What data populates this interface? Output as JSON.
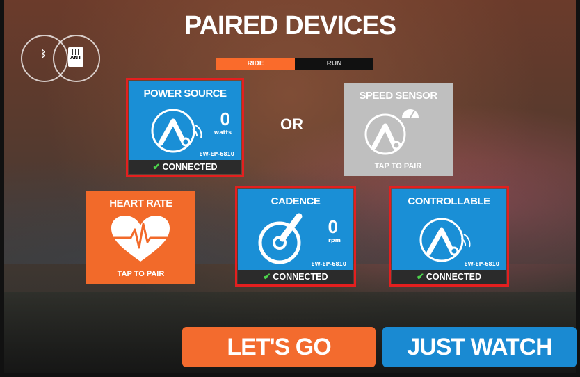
{
  "screen": {
    "title": "PAIRED DEVICES"
  },
  "sport_toggle": {
    "ride_label": "RIDE",
    "run_label": "RUN",
    "selected": "RIDE"
  },
  "connection_icons": {
    "bluetooth": "bluetooth-icon",
    "ant_label": "ANT"
  },
  "tiles": {
    "power_source": {
      "title": "POWER SOURCE",
      "value": "0",
      "unit": "watts",
      "device_id": "EW-EP-6810",
      "status": "CONNECTED",
      "icon": "power-wheel-icon"
    },
    "speed_sensor": {
      "title": "SPEED SENSOR",
      "action": "TAP TO PAIR",
      "icon": "speed-sensor-icon"
    },
    "heart_rate": {
      "title": "HEART RATE",
      "action": "TAP TO PAIR",
      "icon": "heart-icon"
    },
    "cadence": {
      "title": "CADENCE",
      "value": "0",
      "unit": "rpm",
      "device_id": "EW-EP-6810",
      "status": "CONNECTED",
      "icon": "crank-icon"
    },
    "controllable": {
      "title": "CONTROLLABLE",
      "device_id": "EW-EP-6810",
      "status": "CONNECTED",
      "icon": "trainer-wheel-icon"
    }
  },
  "or_label": "OR",
  "buttons": {
    "lets_go": "LET'S GO",
    "just_watch": "JUST WATCH"
  },
  "colors": {
    "blue": "#1a8fd6",
    "orange": "#f26a2a",
    "grey": "#bfbfbf",
    "selection": "#e41f1f",
    "connected_check": "#4cd34c"
  }
}
